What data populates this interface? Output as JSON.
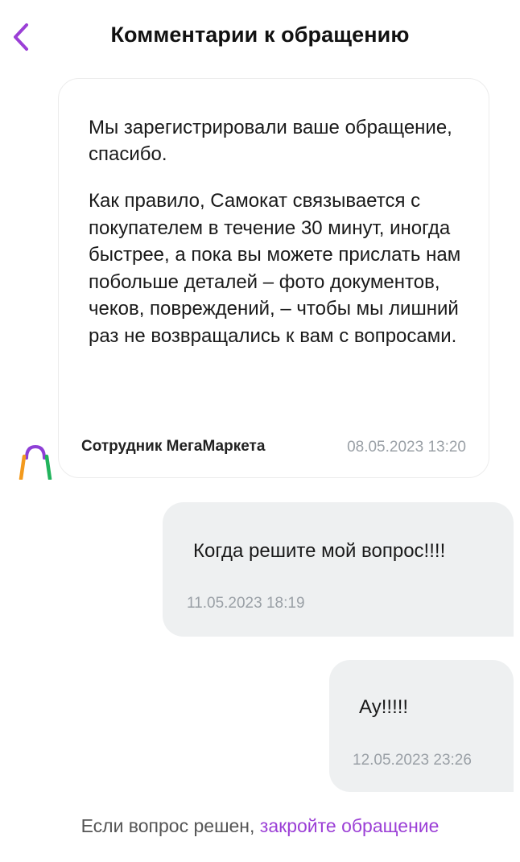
{
  "header": {
    "title": "Комментарии к обращению",
    "back_icon": "chevron-left-icon",
    "accent_color": "#9b3fd6"
  },
  "messages": [
    {
      "author": "agent",
      "paragraphs": [
        "Мы зарегистрировали ваше обращение, спасибо.",
        "Как правило, Самокат связывается с покупателем в течение 30 минут, иногда быстрее, а пока вы можете прислать нам побольше деталей – фото документов, чеков, повреждений, – чтобы мы лишний раз не возвращались к вам с вопросами."
      ],
      "sender": "Сотрудник МегаМаркета",
      "time": "08.05.2023 13:20",
      "avatar_icon": "shopping-bag-logo-icon"
    },
    {
      "author": "user",
      "text": "Когда решите мой вопрос!!!!",
      "time": "11.05.2023 18:19"
    },
    {
      "author": "user",
      "text": "Ау!!!!!",
      "time": "12.05.2023 23:26"
    }
  ],
  "footer": {
    "prefix": "Если вопрос решен,",
    "link": "закройте обращение"
  },
  "colors": {
    "user_bubble": "#eef0f1",
    "timestamp": "#9aa0a6",
    "link": "#9b3fd6"
  }
}
